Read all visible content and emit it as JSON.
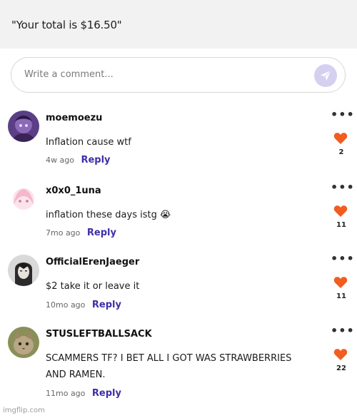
{
  "caption": "\"Your total is $16.50\"",
  "comment_input": {
    "placeholder": "Write a comment..."
  },
  "comments": [
    {
      "username": "moemoezu",
      "text": "Inflation cause wtf",
      "time": "4w ago",
      "reply_label": "Reply",
      "likes": "2"
    },
    {
      "username": "x0x0_1una",
      "text": "inflation these days istg 😭",
      "time": "7mo ago",
      "reply_label": "Reply",
      "likes": "11"
    },
    {
      "username": "OfficialErenJaeger",
      "text": "$2 take it or leave it",
      "time": "10mo ago",
      "reply_label": "Reply",
      "likes": "11"
    },
    {
      "username": "STUSLEFTBALLSACK",
      "text": "SCAMMERS TF? I BET ALL I GOT WAS STRAWBERRIES AND RAMEN.",
      "time": "11mo ago",
      "reply_label": "Reply",
      "likes": "22"
    }
  ],
  "more_label": "•••",
  "watermark": "imgflip.com",
  "colors": {
    "accent": "#3d2fa8",
    "heart": "#f25c1f",
    "send_button": "#d6d0f0",
    "caption_bg": "#f2f2f2"
  },
  "icons": {
    "send": "send-icon",
    "like": "heart-icon",
    "more": "more-options-icon"
  }
}
